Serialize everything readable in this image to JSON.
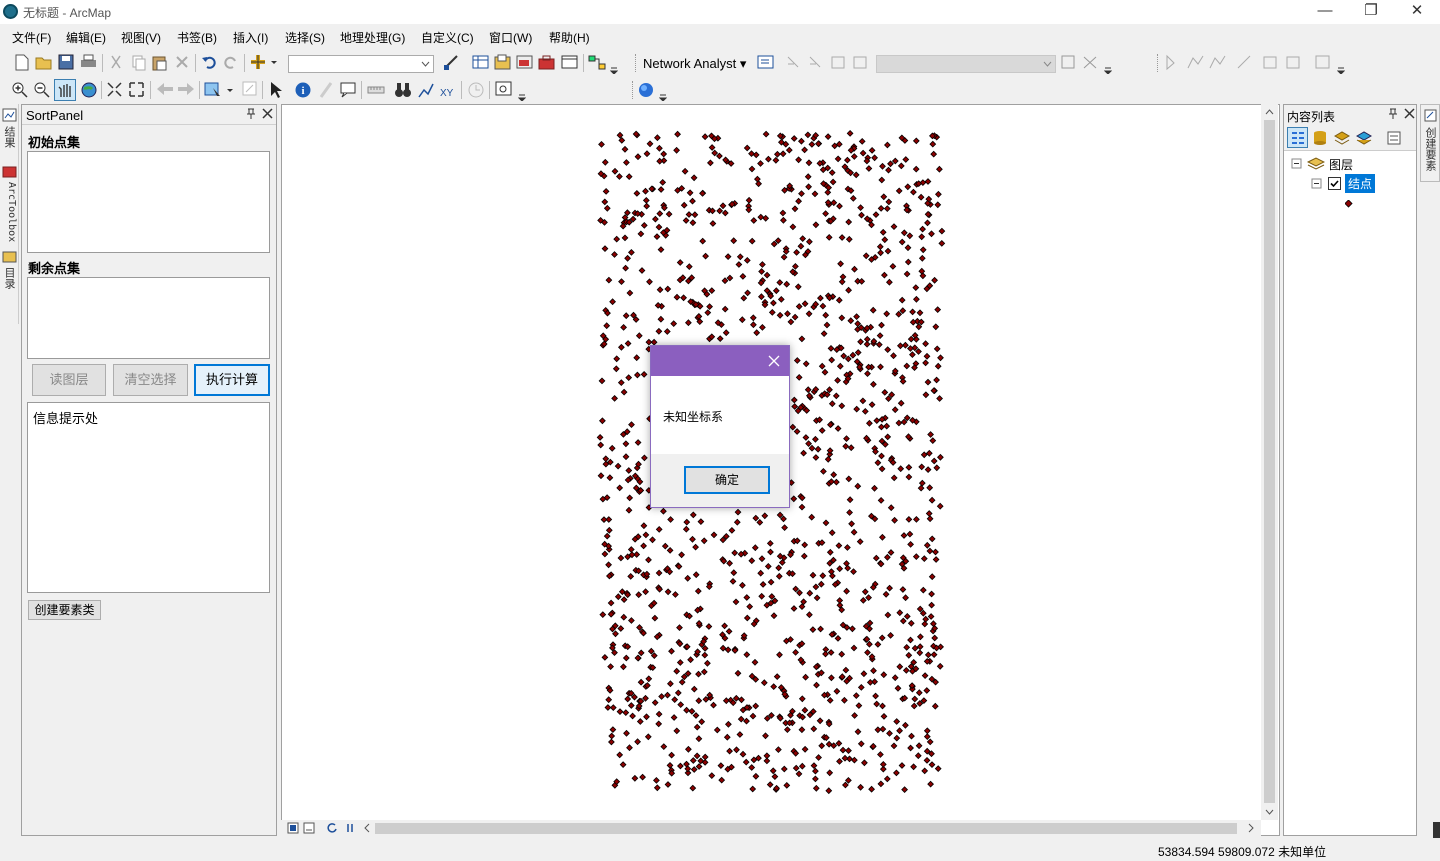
{
  "window": {
    "title": "无标题 - ArcMap",
    "minimize": "—",
    "restore": "❐",
    "close": "✕"
  },
  "menu": [
    "文件(F)",
    "编辑(E)",
    "视图(V)",
    "书签(B)",
    "插入(I)",
    "选择(S)",
    "地理处理(G)",
    "自定义(C)",
    "窗口(W)",
    "帮助(H)"
  ],
  "toolbar": {
    "network_analyst": "Network Analyst ▾"
  },
  "left_tabs": [
    "结果",
    "ArcToolbox",
    "目录"
  ],
  "sort_panel": {
    "title": "SortPanel",
    "initial_label": "初始点集",
    "remaining_label": "剩余点集",
    "read_layer": "读图层",
    "clear_selection": "清空选择",
    "execute": "执行计算",
    "info_text": "信息提示处",
    "create_feature_class": "创建要素类"
  },
  "toc": {
    "title": "内容列表",
    "layers_group": "图层",
    "layer_name": "结点"
  },
  "right_tab": "创建要素",
  "status": {
    "coords": "53834.594  59809.072 未知单位"
  },
  "dialog": {
    "message": "未知坐标系",
    "ok": "确定"
  },
  "colors": {
    "point": "#8b0000",
    "accent": "#0078d7",
    "dialog_title": "#8b5fbf"
  }
}
